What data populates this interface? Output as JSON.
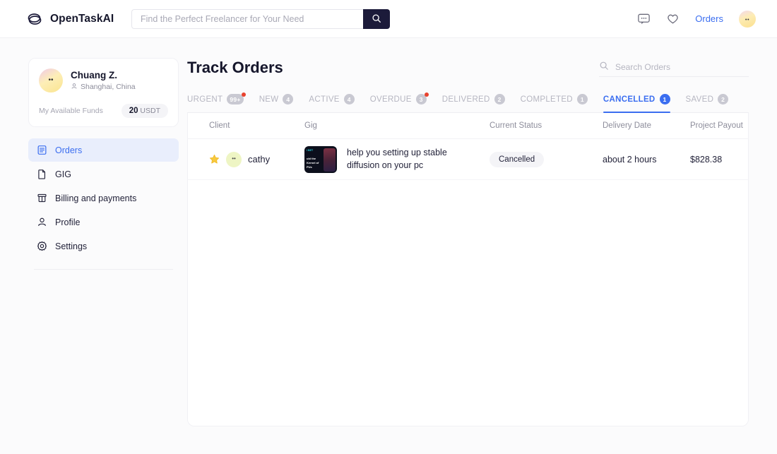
{
  "header": {
    "brand": "OpenTaskAI",
    "logo_icon": "ellipse-logo-icon",
    "search_placeholder": "Find the Perfect Freelancer for Your Need",
    "search_value": "",
    "search_button_icon": "search-icon",
    "chat_icon": "chat-bubble-icon",
    "wishlist_icon": "heart-icon",
    "orders_link": "Orders",
    "avatar_icon": "user-avatar"
  },
  "sidebar": {
    "profile": {
      "name": "Chuang Z.",
      "location": "Shanghai, China",
      "location_icon": "location-user-icon",
      "funds_label": "My Available Funds",
      "funds_amount": "20",
      "funds_currency": "USDT"
    },
    "items": [
      {
        "label": "Orders",
        "icon": "orders-list-icon",
        "active": true
      },
      {
        "label": "GIG",
        "icon": "document-icon",
        "active": false
      },
      {
        "label": "Billing and payments",
        "icon": "billing-icon",
        "active": false
      },
      {
        "label": "Profile",
        "icon": "person-icon",
        "active": false
      },
      {
        "label": "Settings",
        "icon": "gear-icon",
        "active": false
      }
    ]
  },
  "main": {
    "title": "Track Orders",
    "search": {
      "placeholder": "Search Orders",
      "value": "",
      "icon": "search-icon"
    },
    "tabs": [
      {
        "label": "URGENT",
        "badge": "99+",
        "active": false,
        "dot": true
      },
      {
        "label": "NEW",
        "badge": "4",
        "active": false,
        "dot": false
      },
      {
        "label": "ACTIVE",
        "badge": "4",
        "active": false,
        "dot": false
      },
      {
        "label": "OVERDUE",
        "badge": "3",
        "active": false,
        "dot": true
      },
      {
        "label": "DELIVERED",
        "badge": "2",
        "active": false,
        "dot": false
      },
      {
        "label": "COMPLETED",
        "badge": "1",
        "active": false,
        "dot": false
      },
      {
        "label": "CANCELLED",
        "badge": "1",
        "active": true,
        "dot": false
      },
      {
        "label": "SAVED",
        "badge": "2",
        "active": false,
        "dot": false
      }
    ],
    "table": {
      "columns": [
        "Client",
        "Gig",
        "Current Status",
        "Delivery Date",
        "Project Payout"
      ],
      "rows": [
        {
          "starred": true,
          "client": "cathy",
          "gig_title": "help you setting up stable diffusion on your pc",
          "gig_thumb_line1": "I BET",
          "gig_thumb_line2": "uld the\nKernel of\nPUs",
          "status": "Cancelled",
          "delivery_date": "about 2 hours",
          "payout": "$828.38"
        }
      ]
    }
  },
  "colors": {
    "accent": "#3b6ef0",
    "brand_dark": "#1c1b3a",
    "alert_dot": "#e8432f",
    "badge_gray": "#c9c9d2"
  }
}
